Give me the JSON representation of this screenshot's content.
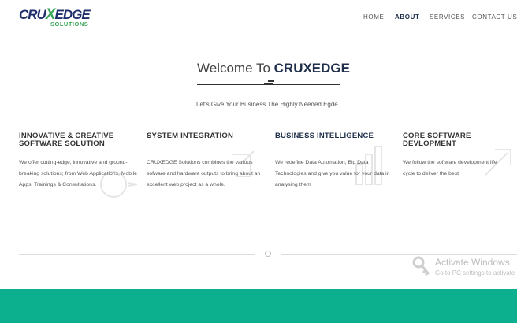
{
  "header": {
    "logo": {
      "main_prefix": "CRU",
      "main_x": "X",
      "main_suffix": "EDGE",
      "sub": "SOLUTIONS"
    },
    "nav": [
      {
        "label": "HOME",
        "active": false
      },
      {
        "label": "ABOUT",
        "active": true
      },
      {
        "label": "SERVICES",
        "active": false
      },
      {
        "label": "CONTACT US",
        "active": false
      }
    ]
  },
  "hero": {
    "welcome_prefix": "Welcome To ",
    "welcome_brand": "CRUXEDGE",
    "tagline": "Let's Give Your Business The Highly Needed Egde."
  },
  "features": [
    {
      "title": "INNOVATIVE & CREATIVE SOFTWARE SOLUTION",
      "text": "We offer cutting-edge, innovative and ground-breaking solutions; from Web Applications, Mobile Apps, Trainings & Consultations."
    },
    {
      "title": "SYSTEM INTEGRATION",
      "text": "CRUXEDGE Solutions combines the various sofware and hardware outputs to bring about an excellent web project as a whole."
    },
    {
      "title": "BUSINESS INTELLIGENCE",
      "text": "We redefine Data Automation, Big Data Technologies and give you value for your data in analysing them"
    },
    {
      "title": "CORE SOFTWARE DEVLOPMENT",
      "text": "We follow the software development life cycle to deliver the best"
    }
  ],
  "watermark": {
    "title": "Activate Windows",
    "subtitle": "Go to PC settings to activate"
  },
  "colors": {
    "brand_navy": "#1f2f6b",
    "brand_green": "#3aa657",
    "footer_band": "#0db08e"
  }
}
